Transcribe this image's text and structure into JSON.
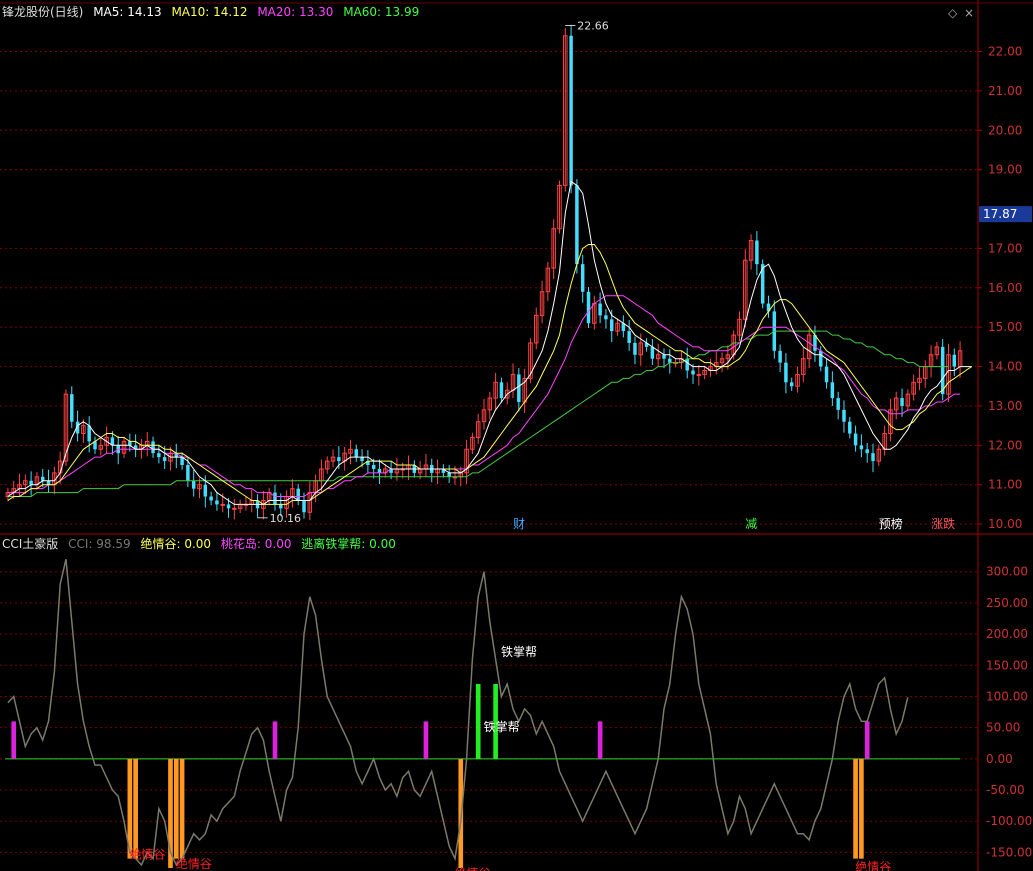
{
  "price_panel": {
    "title": "锋龙股份(日线)",
    "ma": [
      {
        "label": "MA5: 14.13",
        "color": "#ffffff"
      },
      {
        "label": "MA10: 14.12",
        "color": "#ffff55"
      },
      {
        "label": "MA20: 13.30",
        "color": "#ff44ff"
      },
      {
        "label": "MA60: 13.99",
        "color": "#44ff44"
      }
    ],
    "window_controls": {
      "diamond": "◇",
      "close": "×"
    }
  },
  "cci_panel": {
    "title": "CCI土豪版",
    "items": [
      {
        "label": "CCI: 98.59",
        "color": "#666666"
      },
      {
        "label": "绝情谷: 0.00",
        "color": "#ffff55"
      },
      {
        "label": "桃花岛: 0.00",
        "color": "#ff44ff"
      },
      {
        "label": "逃离铁掌帮: 0.00",
        "color": "#44ff44"
      }
    ]
  },
  "chart_data": [
    {
      "type": "candlestick",
      "y_ticks": [
        "10.00",
        "11.00",
        "12.00",
        "13.00",
        "14.00",
        "15.00",
        "16.00",
        "17.00",
        "19.00",
        "20.00",
        "21.00",
        "22.00"
      ],
      "ylim": [
        9.85,
        22.8
      ],
      "last_price": "17.87",
      "annotations": [
        {
          "text": "22.66",
          "x_index": 96,
          "y": 22.66
        },
        {
          "text": "10.16",
          "x_index": 43,
          "y": 10.16
        },
        {
          "text": "财",
          "x_index": 87,
          "y": 9.95,
          "color": "#44aaff"
        },
        {
          "text": "减",
          "x_index": 127,
          "y": 9.95,
          "color": "#44ff44"
        },
        {
          "text": "预榜",
          "x_index": 150,
          "y": 9.95,
          "color": "#ffffff"
        },
        {
          "text": "涨跌",
          "x_index": 159,
          "y": 9.95,
          "color": "#ff5555"
        }
      ],
      "close": [
        10.8,
        10.9,
        11.0,
        11.1,
        11.0,
        11.2,
        11.1,
        11.0,
        11.3,
        11.6,
        13.3,
        12.6,
        12.3,
        12.5,
        12.1,
        11.9,
        12.0,
        12.2,
        12.0,
        11.8,
        12.1,
        12.0,
        11.9,
        12.0,
        12.1,
        11.8,
        11.7,
        11.6,
        11.8,
        11.7,
        11.5,
        11.1,
        10.9,
        11.0,
        10.7,
        10.6,
        10.5,
        10.5,
        10.4,
        10.4,
        10.5,
        10.5,
        10.6,
        10.4,
        10.6,
        10.8,
        10.5,
        10.4,
        10.7,
        10.9,
        10.6,
        10.3,
        10.8,
        11.1,
        11.4,
        11.6,
        11.7,
        11.6,
        11.8,
        11.9,
        11.7,
        11.6,
        11.5,
        11.4,
        11.3,
        11.4,
        11.3,
        11.4,
        11.4,
        11.5,
        11.3,
        11.4,
        11.5,
        11.3,
        11.4,
        11.3,
        11.2,
        11.2,
        11.3,
        11.9,
        12.2,
        12.6,
        12.9,
        13.2,
        13.6,
        13.2,
        13.4,
        13.8,
        13.1,
        13.7,
        14.6,
        15.3,
        15.9,
        16.5,
        17.5,
        18.6,
        22.4,
        18.6,
        16.6,
        15.9,
        15.1,
        15.6,
        15.3,
        15.2,
        14.9,
        15.1,
        14.9,
        14.6,
        14.3,
        14.6,
        14.5,
        14.2,
        14.3,
        14.2,
        14.1,
        14.1,
        14.2,
        13.9,
        13.8,
        13.8,
        13.9,
        14.0,
        14.1,
        14.2,
        14.3,
        14.8,
        15.2,
        16.7,
        17.2,
        16.6,
        15.6,
        15.4,
        14.4,
        14.1,
        13.6,
        13.5,
        13.8,
        14.2,
        14.8,
        14.4,
        14.0,
        13.6,
        13.2,
        12.9,
        12.6,
        12.3,
        12.0,
        11.9,
        11.8,
        11.6,
        11.9,
        12.3,
        12.9,
        13.2,
        13.0,
        13.3,
        13.6,
        13.7,
        14.0,
        14.3,
        14.5,
        13.3,
        14.3,
        14.0,
        14.4
      ],
      "ma5": [
        10.7,
        10.8,
        10.9,
        10.9,
        11.0,
        11.0,
        11.1,
        11.1,
        11.1,
        11.3,
        11.8,
        12.2,
        12.5,
        12.6,
        12.5,
        12.3,
        12.2,
        12.1,
        12.0,
        12.0,
        12.0,
        12.0,
        11.9,
        11.9,
        12.0,
        11.9,
        11.9,
        11.8,
        11.7,
        11.7,
        11.7,
        11.6,
        11.4,
        11.2,
        11.1,
        11.0,
        10.8,
        10.7,
        10.6,
        10.5,
        10.5,
        10.5,
        10.5,
        10.5,
        10.5,
        10.6,
        10.6,
        10.6,
        10.6,
        10.7,
        10.6,
        10.6,
        10.6,
        10.8,
        10.9,
        11.1,
        11.3,
        11.5,
        11.6,
        11.7,
        11.7,
        11.7,
        11.7,
        11.6,
        11.6,
        11.5,
        11.4,
        11.4,
        11.4,
        11.4,
        11.4,
        11.4,
        11.4,
        11.4,
        11.4,
        11.4,
        11.3,
        11.3,
        11.3,
        11.4,
        11.6,
        11.8,
        12.2,
        12.6,
        12.9,
        13.1,
        13.3,
        13.4,
        13.5,
        13.6,
        13.8,
        14.1,
        14.4,
        14.9,
        15.6,
        16.4,
        17.9,
        18.7,
        18.6,
        18.4,
        17.6,
        16.7,
        16.1,
        15.6,
        15.3,
        15.2,
        15.1,
        15.0,
        14.8,
        14.7,
        14.6,
        14.5,
        14.4,
        14.3,
        14.3,
        14.2,
        14.2,
        14.1,
        14.0,
        14.0,
        14.0,
        13.9,
        13.9,
        14.0,
        14.1,
        14.3,
        14.5,
        15.1,
        15.7,
        16.2,
        16.5,
        16.6,
        16.3,
        15.8,
        15.4,
        15.0,
        14.7,
        14.5,
        14.4,
        14.3,
        14.3,
        14.2,
        14.1,
        14.0,
        13.8,
        13.5,
        13.2,
        12.9,
        12.6,
        12.3,
        12.1,
        11.9,
        11.9,
        12.0,
        12.2,
        12.4,
        12.7,
        12.9,
        13.2,
        13.4,
        13.5,
        13.7,
        13.9,
        13.9,
        14.0,
        14.0,
        14.0
      ],
      "ma10": [
        10.6,
        10.7,
        10.7,
        10.8,
        10.9,
        10.9,
        11.0,
        11.0,
        11.0,
        11.1,
        11.3,
        11.5,
        11.7,
        11.9,
        12.0,
        12.1,
        12.2,
        12.3,
        12.3,
        12.2,
        12.2,
        12.1,
        12.1,
        12.0,
        12.0,
        12.0,
        12.0,
        11.9,
        11.9,
        11.8,
        11.8,
        11.7,
        11.6,
        11.5,
        11.4,
        11.3,
        11.2,
        11.1,
        11.0,
        10.9,
        10.8,
        10.7,
        10.6,
        10.6,
        10.5,
        10.5,
        10.5,
        10.5,
        10.5,
        10.6,
        10.6,
        10.6,
        10.6,
        10.7,
        10.8,
        10.9,
        11.0,
        11.1,
        11.2,
        11.3,
        11.4,
        11.5,
        11.6,
        11.6,
        11.6,
        11.6,
        11.6,
        11.5,
        11.5,
        11.5,
        11.5,
        11.4,
        11.4,
        11.4,
        11.4,
        11.4,
        11.4,
        11.4,
        11.3,
        11.4,
        11.5,
        11.6,
        11.7,
        11.9,
        12.1,
        12.3,
        12.5,
        12.7,
        12.9,
        13.1,
        13.3,
        13.5,
        13.8,
        14.1,
        14.4,
        14.8,
        15.5,
        16.1,
        16.6,
        17.0,
        17.1,
        17.1,
        16.9,
        16.6,
        16.2,
        15.8,
        15.5,
        15.3,
        15.1,
        15.0,
        14.9,
        14.8,
        14.7,
        14.6,
        14.5,
        14.4,
        14.4,
        14.3,
        14.2,
        14.2,
        14.1,
        14.1,
        14.0,
        14.0,
        14.0,
        14.1,
        14.2,
        14.4,
        14.7,
        14.9,
        15.2,
        15.4,
        15.6,
        15.7,
        15.7,
        15.6,
        15.4,
        15.2,
        15.0,
        14.8,
        14.6,
        14.4,
        14.3,
        14.2,
        14.1,
        13.9,
        13.7,
        13.5,
        13.3,
        13.1,
        12.9,
        12.7,
        12.5,
        12.4,
        12.4,
        12.5,
        12.6,
        12.8,
        12.9,
        13.1,
        13.3,
        13.4,
        13.6,
        13.7,
        13.8,
        13.9,
        14.0
      ],
      "ma20": [
        10.8,
        10.8,
        10.8,
        10.8,
        10.9,
        10.9,
        10.9,
        11.0,
        11.0,
        11.1,
        11.2,
        11.3,
        11.4,
        11.5,
        11.6,
        11.7,
        11.7,
        11.8,
        11.8,
        11.9,
        11.9,
        11.9,
        11.9,
        11.9,
        11.9,
        11.9,
        11.9,
        11.8,
        11.8,
        11.8,
        11.7,
        11.7,
        11.6,
        11.5,
        11.5,
        11.4,
        11.3,
        11.2,
        11.1,
        11.0,
        11.0,
        10.9,
        10.9,
        10.8,
        10.8,
        10.8,
        10.7,
        10.7,
        10.7,
        10.7,
        10.7,
        10.7,
        10.8,
        10.8,
        10.8,
        10.9,
        10.9,
        11.0,
        11.1,
        11.1,
        11.2,
        11.2,
        11.3,
        11.3,
        11.3,
        11.3,
        11.4,
        11.4,
        11.4,
        11.4,
        11.4,
        11.4,
        11.4,
        11.4,
        11.4,
        11.4,
        11.4,
        11.4,
        11.4,
        11.4,
        11.5,
        11.5,
        11.6,
        11.7,
        11.8,
        11.9,
        12.0,
        12.2,
        12.3,
        12.5,
        12.7,
        12.9,
        13.1,
        13.3,
        13.6,
        13.9,
        14.2,
        14.6,
        14.9,
        15.2,
        15.4,
        15.6,
        15.7,
        15.8,
        15.8,
        15.8,
        15.8,
        15.7,
        15.6,
        15.5,
        15.4,
        15.3,
        15.1,
        15.0,
        14.9,
        14.8,
        14.7,
        14.6,
        14.5,
        14.5,
        14.4,
        14.4,
        14.4,
        14.4,
        14.4,
        14.5,
        14.6,
        14.7,
        14.8,
        14.9,
        15.0,
        15.0,
        15.0,
        15.0,
        15.0,
        14.9,
        14.8,
        14.7,
        14.6,
        14.5,
        14.4,
        14.3,
        14.2,
        14.0,
        13.9,
        13.7,
        13.5,
        13.3,
        13.2,
        13.0,
        12.9,
        12.9,
        12.8,
        12.8,
        12.8,
        12.9,
        12.9,
        12.9,
        13.0,
        13.0,
        13.1,
        13.1,
        13.2,
        13.3,
        13.3
      ],
      "ma60": [
        10.7,
        10.7,
        10.7,
        10.7,
        10.7,
        10.8,
        10.8,
        10.8,
        10.8,
        10.8,
        10.8,
        10.8,
        10.8,
        10.9,
        10.9,
        10.9,
        10.9,
        10.9,
        10.9,
        10.9,
        11.0,
        11.0,
        11.0,
        11.0,
        11.0,
        11.0,
        11.0,
        11.0,
        11.0,
        11.1,
        11.1,
        11.1,
        11.1,
        11.1,
        11.1,
        11.1,
        11.1,
        11.1,
        11.1,
        11.1,
        11.1,
        11.1,
        11.1,
        11.1,
        11.1,
        11.1,
        11.1,
        11.1,
        11.1,
        11.1,
        11.1,
        11.1,
        11.1,
        11.1,
        11.1,
        11.1,
        11.1,
        11.2,
        11.2,
        11.2,
        11.2,
        11.2,
        11.2,
        11.2,
        11.2,
        11.2,
        11.2,
        11.2,
        11.2,
        11.2,
        11.2,
        11.2,
        11.2,
        11.2,
        11.2,
        11.2,
        11.2,
        11.2,
        11.2,
        11.2,
        11.3,
        11.3,
        11.4,
        11.5,
        11.6,
        11.7,
        11.8,
        11.9,
        12.0,
        12.1,
        12.2,
        12.3,
        12.4,
        12.5,
        12.6,
        12.7,
        12.8,
        12.9,
        13.0,
        13.1,
        13.2,
        13.3,
        13.4,
        13.5,
        13.6,
        13.6,
        13.7,
        13.7,
        13.8,
        13.8,
        13.9,
        13.9,
        14.0,
        14.0,
        14.1,
        14.1,
        14.1,
        14.2,
        14.2,
        14.3,
        14.3,
        14.4,
        14.4,
        14.5,
        14.5,
        14.6,
        14.6,
        14.7,
        14.7,
        14.8,
        14.8,
        14.8,
        14.9,
        14.9,
        14.9,
        14.9,
        14.9,
        14.9,
        14.9,
        14.9,
        14.9,
        14.9,
        14.8,
        14.8,
        14.7,
        14.7,
        14.6,
        14.6,
        14.5,
        14.5,
        14.4,
        14.3,
        14.3,
        14.2,
        14.2,
        14.1,
        14.1,
        14.0,
        14.0,
        14.0,
        14.0,
        14.0,
        14.0
      ]
    },
    {
      "type": "line",
      "y_ticks": [
        "-150.00",
        "-100.00",
        "-50.00",
        "0.00",
        "50.00",
        "100.00",
        "150.00",
        "200.00",
        "250.00",
        "300.00"
      ],
      "ylim": [
        -175,
        330
      ],
      "cci": [
        90,
        100,
        60,
        20,
        40,
        50,
        30,
        60,
        140,
        280,
        320,
        220,
        120,
        60,
        20,
        -10,
        -10,
        -30,
        -50,
        -60,
        -100,
        -150,
        -160,
        -170,
        -150,
        -160,
        -80,
        -100,
        -150,
        -170,
        -160,
        -140,
        -120,
        -130,
        -120,
        -90,
        -100,
        -80,
        -70,
        -60,
        -20,
        10,
        40,
        50,
        30,
        -20,
        -60,
        -100,
        -50,
        -30,
        50,
        200,
        260,
        230,
        160,
        100,
        80,
        60,
        40,
        20,
        -20,
        -40,
        -20,
        0,
        -30,
        -50,
        -40,
        -60,
        -30,
        -20,
        -50,
        -60,
        -40,
        -20,
        -60,
        -100,
        -140,
        -160,
        -100,
        0,
        160,
        260,
        300,
        220,
        160,
        100,
        120,
        80,
        60,
        80,
        70,
        40,
        60,
        40,
        20,
        -20,
        -40,
        -60,
        -80,
        -100,
        -80,
        -60,
        -40,
        -20,
        -40,
        -60,
        -80,
        -100,
        -120,
        -100,
        -80,
        -40,
        0,
        80,
        120,
        200,
        260,
        240,
        200,
        120,
        80,
        40,
        -40,
        -80,
        -120,
        -100,
        -60,
        -80,
        -120,
        -100,
        -80,
        -60,
        -40,
        -60,
        -80,
        -100,
        -120,
        -120,
        -130,
        -100,
        -80,
        -40,
        0,
        60,
        100,
        120,
        80,
        60,
        60,
        90,
        120,
        130,
        80,
        40,
        60,
        98.59
      ],
      "bars_jueqinggu": [
        {
          "i": 21,
          "v": -160
        },
        {
          "i": 22,
          "v": -160
        },
        {
          "i": 28,
          "v": -175
        },
        {
          "i": 29,
          "v": -160
        },
        {
          "i": 30,
          "v": -160
        },
        {
          "i": 78,
          "v": -175
        },
        {
          "i": 146,
          "v": -160
        },
        {
          "i": 147,
          "v": -160
        }
      ],
      "bars_taohuadao": [
        {
          "i": 1,
          "v": 60
        },
        {
          "i": 46,
          "v": 60
        },
        {
          "i": 72,
          "v": 60
        },
        {
          "i": 102,
          "v": 60
        },
        {
          "i": 148,
          "v": 60
        }
      ],
      "bars_tiezhangbang": [
        {
          "i": 81,
          "v": 120
        },
        {
          "i": 84,
          "v": 120
        }
      ],
      "annotations": [
        {
          "text": "绝情谷",
          "x_index": 23,
          "y": -160,
          "color": "#ff2222"
        },
        {
          "text": "绝情谷",
          "x_index": 31,
          "y": -175,
          "color": "#ff2222"
        },
        {
          "text": "绝情谷",
          "x_index": 79,
          "y": -190,
          "color": "#ff2222"
        },
        {
          "text": "绝情谷",
          "x_index": 148,
          "y": -180,
          "color": "#ff2222"
        },
        {
          "text": "铁掌帮",
          "x_index": 87,
          "y": 165,
          "color": "#ffffff"
        },
        {
          "text": "铁掌帮",
          "x_index": 84,
          "y": 45,
          "color": "#ffffff"
        }
      ]
    }
  ]
}
